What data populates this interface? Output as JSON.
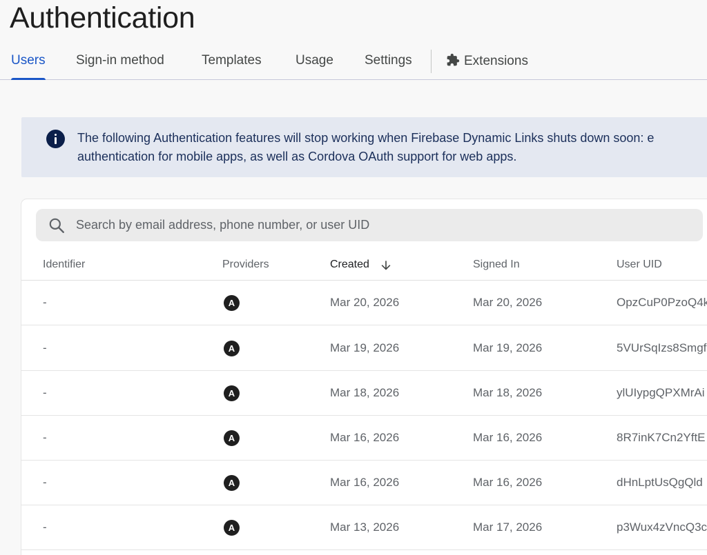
{
  "page": {
    "title": "Authentication"
  },
  "tabs": [
    {
      "label": "Users",
      "active": true
    },
    {
      "label": "Sign-in method"
    },
    {
      "label": "Templates"
    },
    {
      "label": "Usage"
    },
    {
      "label": "Settings"
    },
    {
      "label": "Extensions",
      "icon": "puzzle-piece-icon"
    }
  ],
  "banner": {
    "icon": "info-icon",
    "line1": "The following Authentication features will stop working when Firebase Dynamic Links shuts down soon: e",
    "line2": "authentication for mobile apps, as well as Cordova OAuth support for web apps."
  },
  "search": {
    "icon": "search-icon",
    "placeholder": "Search by email address, phone number, or user UID",
    "value": ""
  },
  "table": {
    "columns": [
      "Identifier",
      "Providers",
      "Created",
      "Signed In",
      "User UID"
    ],
    "sort": {
      "column": "Created",
      "icon": "arrow-down-icon"
    },
    "rows": [
      {
        "identifier": "-",
        "provider": "A",
        "created": "Mar 20, 2026",
        "signed_in": "Mar 20, 2026",
        "uid": "OpzCuP0PzoQ4k"
      },
      {
        "identifier": "-",
        "provider": "A",
        "created": "Mar 19, 2026",
        "signed_in": "Mar 19, 2026",
        "uid": "5VUrSqIzs8Smgf"
      },
      {
        "identifier": "-",
        "provider": "A",
        "created": "Mar 18, 2026",
        "signed_in": "Mar 18, 2026",
        "uid": "ylUIypgQPXMrAi"
      },
      {
        "identifier": "-",
        "provider": "A",
        "created": "Mar 16, 2026",
        "signed_in": "Mar 16, 2026",
        "uid": "8R7inK7Cn2YftE"
      },
      {
        "identifier": "-",
        "provider": "A",
        "created": "Mar 16, 2026",
        "signed_in": "Mar 16, 2026",
        "uid": "dHnLptUsQgQld"
      },
      {
        "identifier": "-",
        "provider": "A",
        "created": "Mar 13, 2026",
        "signed_in": "Mar 17, 2026",
        "uid": "p3Wux4zVncQ3c"
      }
    ]
  },
  "colors": {
    "accent": "#1a56c7",
    "banner_bg": "#e4e8f1",
    "banner_icon": "#0b1f4a"
  }
}
